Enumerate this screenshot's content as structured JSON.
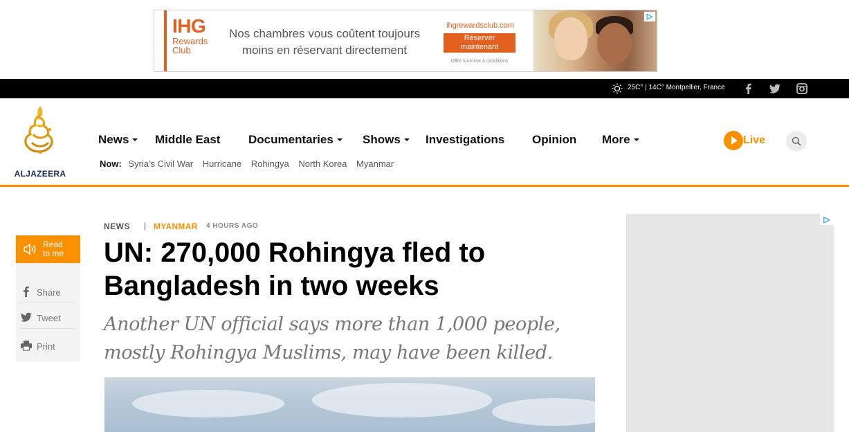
{
  "ad": {
    "brand": "IHG",
    "brand_sub_1": "Rewards",
    "brand_sub_2": "Club",
    "tagline_1": "Nos chambres vous coûtent toujours",
    "tagline_2": "moins en réservant directement",
    "url": "ihgrewardsclub.com",
    "cta_1": "Réserver",
    "cta_2": "maintenant",
    "fine_print": "Offre soumise à conditions",
    "accent_color": "#e2611f"
  },
  "topbar": {
    "weather": "25C° | 14C° Montpellier, France",
    "weather_icon": "sun-icon",
    "social": [
      "facebook-icon",
      "twitter-icon",
      "instagram-icon"
    ]
  },
  "header": {
    "logo_text": "ALJAZEERA",
    "nav": [
      {
        "label": "News",
        "dropdown": true
      },
      {
        "label": "Middle East",
        "dropdown": false
      },
      {
        "label": "Documentaries",
        "dropdown": true
      },
      {
        "label": "Shows",
        "dropdown": true
      },
      {
        "label": "Investigations",
        "dropdown": false
      },
      {
        "label": "Opinion",
        "dropdown": false
      },
      {
        "label": "More",
        "dropdown": true
      }
    ],
    "now_label": "Now:",
    "now_links": [
      "Syria's Civil War",
      "Hurricane",
      "Rohingya",
      "North Korea",
      "Myanmar"
    ],
    "live_label": "Live",
    "accent_color": "#fa9000"
  },
  "article": {
    "section": "NEWS",
    "separator": "|",
    "topic": "MYANMAR",
    "time": "4 HOURS AGO",
    "headline": "UN: 270,000 Rohingya fled to Bangladesh in two weeks",
    "subhead": "Another UN official says more than 1,000 people, mostly Rohingya Muslims, may have been killed."
  },
  "rail": {
    "read_1": "Read",
    "read_2": "to me",
    "share": "Share",
    "tweet": "Tweet",
    "print": "Print"
  }
}
